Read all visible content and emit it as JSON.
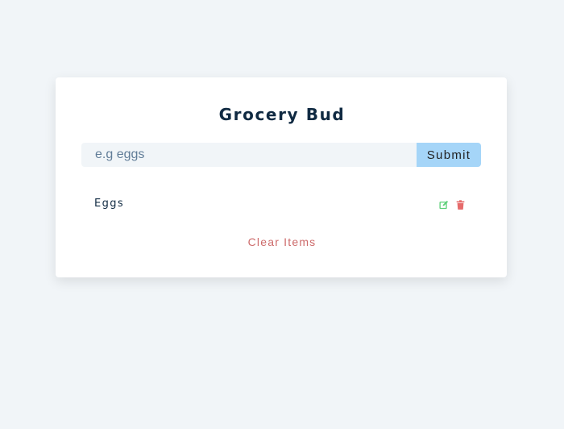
{
  "app": {
    "title": "Grocery Bud"
  },
  "form": {
    "input_value": "",
    "input_placeholder": "e.g eggs",
    "submit_label": "Submit"
  },
  "items": [
    {
      "title": "Eggs",
      "edit_icon": "edit-icon",
      "delete_icon": "trash-icon"
    }
  ],
  "actions": {
    "clear_label": "Clear Items"
  },
  "colors": {
    "background": "#f1f5f8",
    "title": "#102a42",
    "submit_bg": "#a5d5f8",
    "edit": "#5fd07a",
    "delete": "#e66b6b",
    "clear": "#cd6b6b"
  }
}
